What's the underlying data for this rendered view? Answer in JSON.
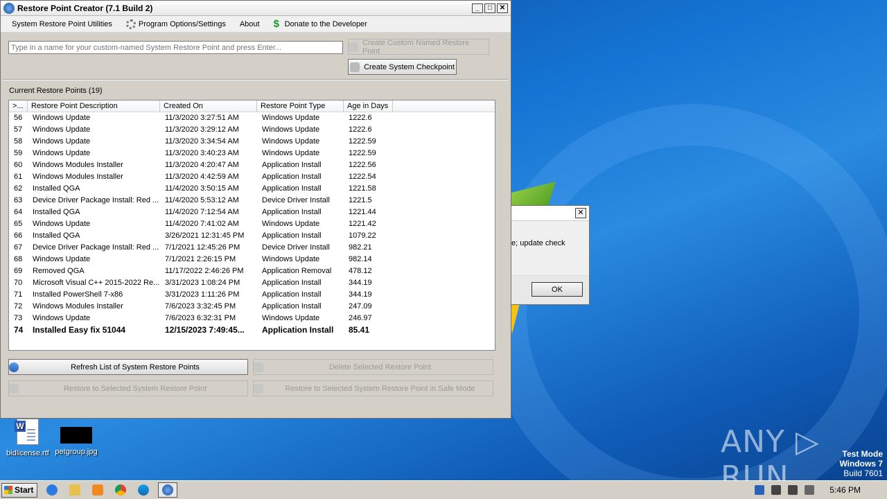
{
  "window": {
    "title": "Restore Point Creator (7.1 Build 2)",
    "controls": {
      "minimize": "_",
      "maximize": "□",
      "close": "✕"
    }
  },
  "menu": {
    "utilities": "System Restore Point Utilities",
    "options": "Program Options/Settings",
    "about": "About",
    "donate": "Donate to the Developer"
  },
  "create": {
    "name_placeholder": "Type in a name for your custom-named System Restore Point and press Enter...",
    "custom_button": "Create Custom Named Restore Point",
    "checkpoint_button": "Create System Checkpoint"
  },
  "list": {
    "label": "Current Restore Points (19)",
    "columns": [
      ">...",
      "Restore Point Description",
      "Created On",
      "Restore Point Type",
      "Age in Days"
    ],
    "rows": [
      [
        "56",
        "Windows Update",
        "11/3/2020 3:27:51 AM",
        "Windows Update",
        "1222.6"
      ],
      [
        "57",
        "Windows Update",
        "11/3/2020 3:29:12 AM",
        "Windows Update",
        "1222.6"
      ],
      [
        "58",
        "Windows Update",
        "11/3/2020 3:34:54 AM",
        "Windows Update",
        "1222.59"
      ],
      [
        "59",
        "Windows Update",
        "11/3/2020 3:40:23 AM",
        "Windows Update",
        "1222.59"
      ],
      [
        "60",
        "Windows Modules Installer",
        "11/3/2020 4:20:47 AM",
        "Application Install",
        "1222.56"
      ],
      [
        "61",
        "Windows Modules Installer",
        "11/3/2020 4:42:59 AM",
        "Application Install",
        "1222.54"
      ],
      [
        "62",
        "Installed QGA",
        "11/4/2020 3:50:15 AM",
        "Application Install",
        "1221.58"
      ],
      [
        "63",
        "Device Driver Package Install: Red ...",
        "11/4/2020 5:53:12 AM",
        "Device Driver Install",
        "1221.5"
      ],
      [
        "64",
        "Installed QGA",
        "11/4/2020 7:12:54 AM",
        "Application Install",
        "1221.44"
      ],
      [
        "65",
        "Windows Update",
        "11/4/2020 7:41:02 AM",
        "Windows Update",
        "1221.42"
      ],
      [
        "66",
        "Installed QGA",
        "3/26/2021 12:31:45 PM",
        "Application Install",
        "1079.22"
      ],
      [
        "67",
        "Device Driver Package Install: Red ...",
        "7/1/2021 12:45:26 PM",
        "Device Driver Install",
        "982.21"
      ],
      [
        "68",
        "Windows Update",
        "7/1/2021 2:26:15 PM",
        "Windows Update",
        "982.14"
      ],
      [
        "69",
        "Removed QGA",
        "11/17/2022 2:46:26 PM",
        "Application Removal",
        "478.12"
      ],
      [
        "70",
        "Microsoft Visual C++ 2015-2022 Re...",
        "3/31/2023 1:08:24 PM",
        "Application Install",
        "344.19"
      ],
      [
        "71",
        "Installed PowerShell 7-x86",
        "3/31/2023 1:11:26 PM",
        "Application Install",
        "344.19"
      ],
      [
        "72",
        "Windows Modules Installer",
        "7/6/2023 3:32:45 PM",
        "Application Install",
        "247.09"
      ],
      [
        "73",
        "Windows Update",
        "7/6/2023 6:32:31 PM",
        "Windows Update",
        "246.97"
      ],
      [
        "74",
        "Installed Easy fix 51044",
        "12/15/2023 7:49:45...",
        "Application Install",
        "85.41"
      ]
    ]
  },
  "actions": {
    "refresh": "Refresh List of System Restore Points",
    "delete": "Delete Selected Restore Point",
    "restore": "Restore to Selected System Restore Point",
    "restore_safe": "Restore to Selected System Restore Point in Safe Mode"
  },
  "dialog": {
    "message": "e; update check",
    "ok": "OK",
    "close": "✕"
  },
  "desktop": {
    "icons": [
      "bidlicense.rtf",
      "petgroup.jpg"
    ],
    "watermark": "ANY ▷ RUN",
    "test_mode": [
      "Test Mode",
      "Windows 7",
      "Build 7601"
    ]
  },
  "taskbar": {
    "start": "Start",
    "clock": "5:46 PM"
  }
}
